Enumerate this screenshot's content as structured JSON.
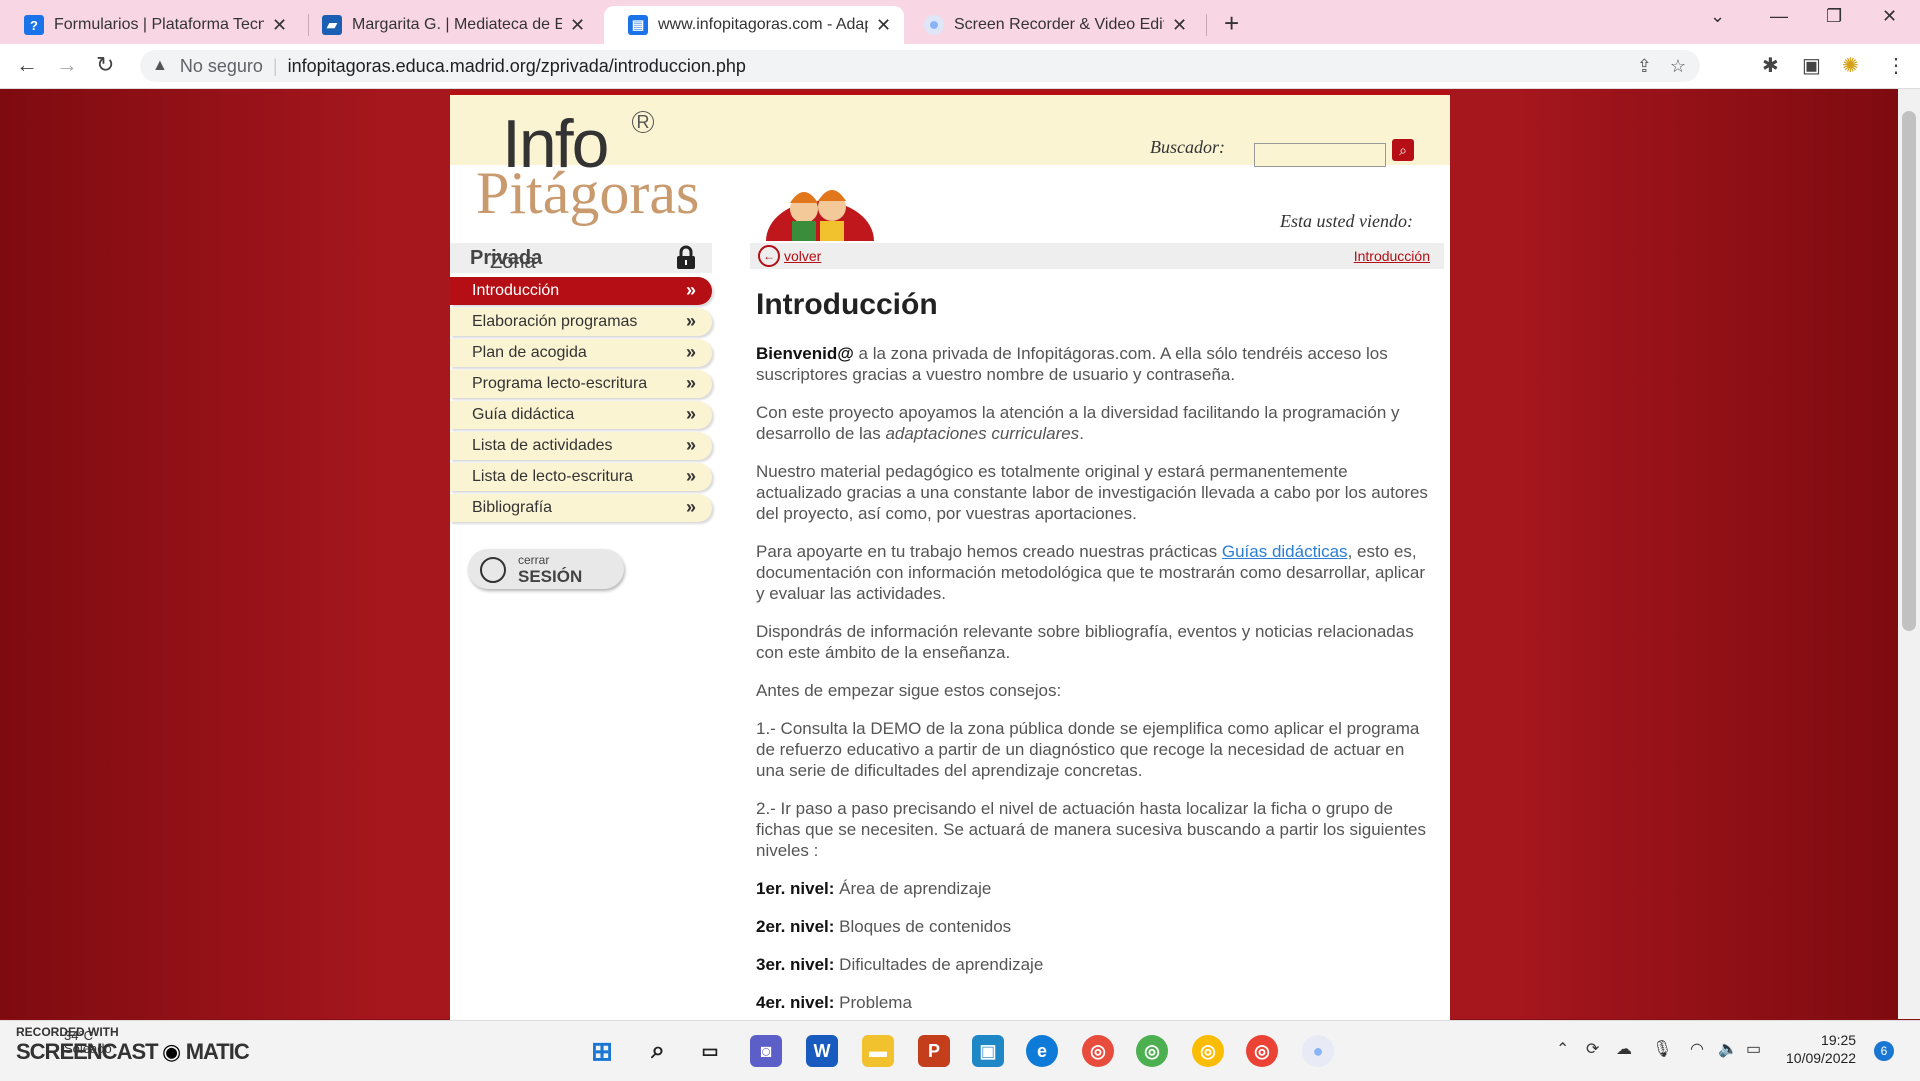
{
  "browser": {
    "tabs": [
      {
        "label": "Formularios | Plataforma Tecnoló",
        "icon": "question-icon",
        "color": "#1a73e8"
      },
      {
        "label": "Margarita G. | Mediateca de Educ",
        "icon": "clapperboard-icon",
        "color": "#1a5fb4"
      },
      {
        "label": "www.infopitagoras.com - Adapta",
        "icon": "document-icon",
        "color": "#1a73e8",
        "active": true
      },
      {
        "label": "Screen Recorder & Video Editor",
        "icon": "record-icon",
        "color": "#8ab4f8"
      }
    ],
    "security": "No seguro",
    "url": "infopitagoras.educa.madrid.org/zprivada/introduccion.php"
  },
  "site": {
    "logo_top": "Info",
    "logo_r": "R",
    "logo_bottom": "Pitágoras",
    "search_label": "Buscador:",
    "viewing_label": "Esta usted viendo:",
    "back_label": "volver",
    "breadcrumb_current": "Introducción",
    "zona_label_1": "Zona ",
    "zona_label_2": "Privada",
    "menu": [
      {
        "label": "Introducción",
        "active": true
      },
      {
        "label": "Elaboración programas"
      },
      {
        "label": "Plan de acogida"
      },
      {
        "label": "Programa lecto-escritura"
      },
      {
        "label": "Guía didáctica"
      },
      {
        "label": "Lista de actividades"
      },
      {
        "label": "Lista de lecto-escritura"
      },
      {
        "label": "Bibliografía"
      }
    ],
    "menu_arrow": "»",
    "logout_small": "cerrar",
    "logout_big": "SESIÓN"
  },
  "content": {
    "title": "Introducción",
    "p1_bold": "Bienvenid@",
    "p1_rest": " a la zona privada de Infopitágoras.com. A ella sólo tendréis acceso los suscriptores gracias a vuestro nombre de usuario y contraseña.",
    "p2_a": "Con este proyecto apoyamos la atención a la diversidad facilitando la programación y desarrollo de las ",
    "p2_em": "adaptaciones curriculares",
    "p2_b": ".",
    "p3": "Nuestro material pedagógico es totalmente original y estará permanentemente actualizado gracias a una constante labor de investigación llevada a cabo por los autores del proyecto, así como, por vuestras aportaciones.",
    "p4_a": "Para apoyarte en tu trabajo hemos creado nuestras prácticas ",
    "p4_link": "Guías didácticas",
    "p4_b": ", esto es, documentación con información metodológica que te mostrarán como desarrollar, aplicar y evaluar las actividades.",
    "p5": "Dispondrás de información relevante sobre bibliografía, eventos y noticias relacionadas con este ámbito de la enseñanza.",
    "p6": "Antes de empezar sigue estos consejos:",
    "p7": "1.- Consulta la DEMO de la zona pública donde se ejemplifica como aplicar el programa de refuerzo educativo a partir de un diagnóstico que recoge la necesidad de actuar en una serie de dificultades del aprendizaje concretas.",
    "p8": "2.- Ir paso a paso precisando el nivel de actuación hasta localizar la ficha o grupo de fichas que se necesiten. Se actuará de manera sucesiva buscando a partir los siguientes niveles :",
    "levels": [
      {
        "label": "1er. nivel:",
        "value": " Área de aprendizaje"
      },
      {
        "label": "2er. nivel:",
        "value": " Bloques de contenidos"
      },
      {
        "label": "3er. nivel:",
        "value": " Dificultades de aprendizaje"
      },
      {
        "label": "4er. nivel:",
        "value": " Problema"
      }
    ]
  },
  "taskbar": {
    "watermark_top": "RECORDED WITH",
    "watermark_bottom": "SCREENCAST",
    "watermark_end": "MATIC",
    "temperature": "34°C",
    "weather": "Soleado",
    "time": "19:25",
    "date": "10/09/2022",
    "notifications": "6"
  }
}
